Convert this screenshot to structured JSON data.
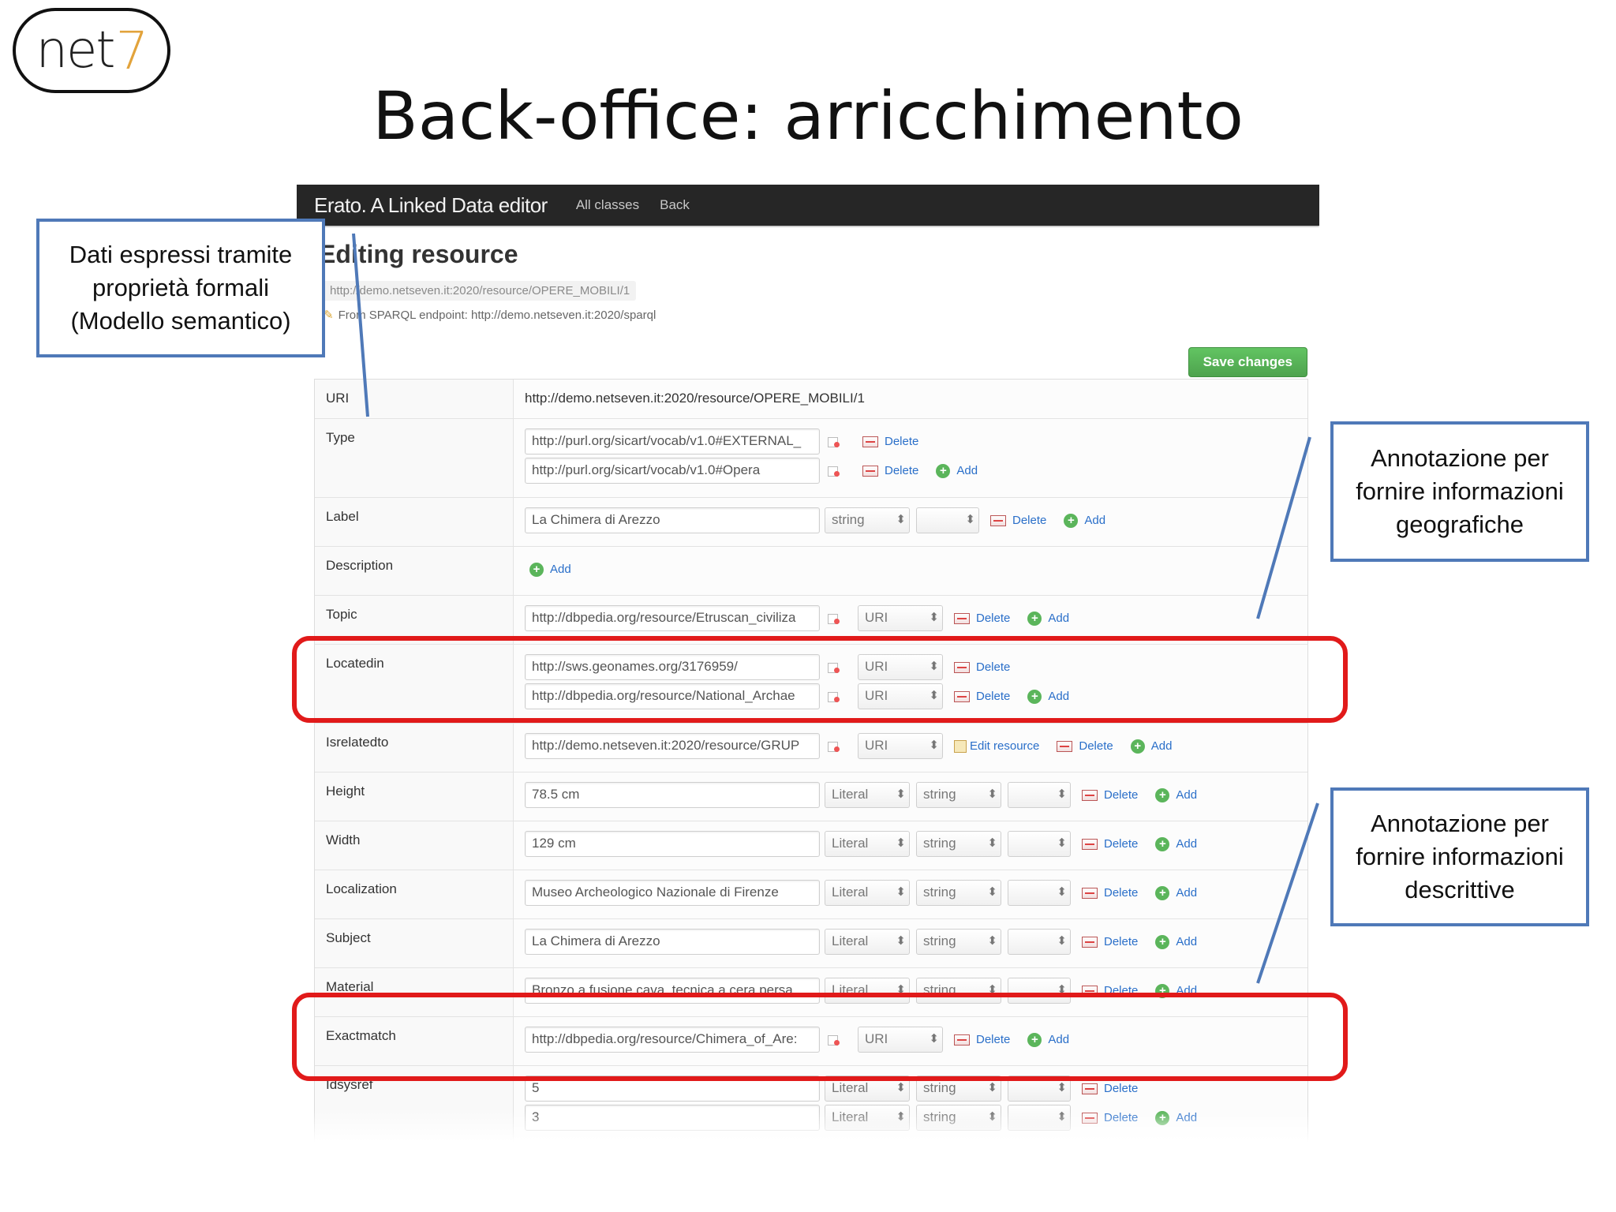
{
  "logo": {
    "text": "net",
    "digit": "7"
  },
  "slide_title": "Back-office: arricchimento",
  "app": {
    "brand": "Erato. A Linked Data editor",
    "nav": [
      "All classes",
      "Back"
    ],
    "heading": "Editing resource",
    "resource_uri": "http://demo.netseven.it:2020/resource/OPERE_MOBILI/1",
    "endpoint": "From SPARQL endpoint: http://demo.netseven.it:2020/sparql",
    "save_label": "Save changes",
    "delete_label": "Delete",
    "add_label": "Add",
    "edit_resource_label": "Edit resource"
  },
  "rows": {
    "uri": {
      "label": "URI",
      "value": "http://demo.netseven.it:2020/resource/OPERE_MOBILI/1"
    },
    "type": {
      "label": "Type",
      "v1": "http://purl.org/sicart/vocab/v1.0#EXTERNAL_",
      "v2": "http://purl.org/sicart/vocab/v1.0#Opera"
    },
    "label": {
      "label": "Label",
      "v1": "La Chimera di Arezzo",
      "type": "string"
    },
    "description": {
      "label": "Description"
    },
    "topic": {
      "label": "Topic",
      "v1": "http://dbpedia.org/resource/Etruscan_civiliza",
      "type": "URI"
    },
    "locatedin": {
      "label": "Locatedin",
      "v1": "http://sws.geonames.org/3176959/",
      "v2": "http://dbpedia.org/resource/National_Archae",
      "type": "URI"
    },
    "isrelatedto": {
      "label": "Isrelatedto",
      "v1": "http://demo.netseven.it:2020/resource/GRUP",
      "type": "URI"
    },
    "height": {
      "label": "Height",
      "v1": "78.5 cm",
      "kind": "Literal",
      "type": "string"
    },
    "width": {
      "label": "Width",
      "v1": "129 cm",
      "kind": "Literal",
      "type": "string"
    },
    "localization": {
      "label": "Localization",
      "v1": "Museo Archeologico Nazionale di Firenze",
      "kind": "Literal",
      "type": "string"
    },
    "subject": {
      "label": "Subject",
      "v1": "La Chimera di Arezzo",
      "kind": "Literal",
      "type": "string"
    },
    "material": {
      "label": "Material",
      "v1": "Bronzo a fusione cava, tecnica a cera persa,",
      "kind": "Literal",
      "type": "string"
    },
    "exactmatch": {
      "label": "Exactmatch",
      "v1": "http://dbpedia.org/resource/Chimera_of_Are:",
      "type": "URI"
    },
    "idsysref": {
      "label": "Idsysref",
      "v1": "5",
      "v2": "3",
      "kind": "Literal",
      "type": "string"
    }
  },
  "callouts": {
    "left": "Dati espressi tramite proprietà formali (Modello semantico)",
    "right_top": "Annotazione per fornire informazioni geografiche",
    "right_bottom": "Annotazione per fornire informazioni descrittive"
  },
  "colors": {
    "highlight": "#e11a1a",
    "callout_border": "#4f79b8",
    "save_button": "#5cb85c",
    "topbar": "#262626"
  }
}
